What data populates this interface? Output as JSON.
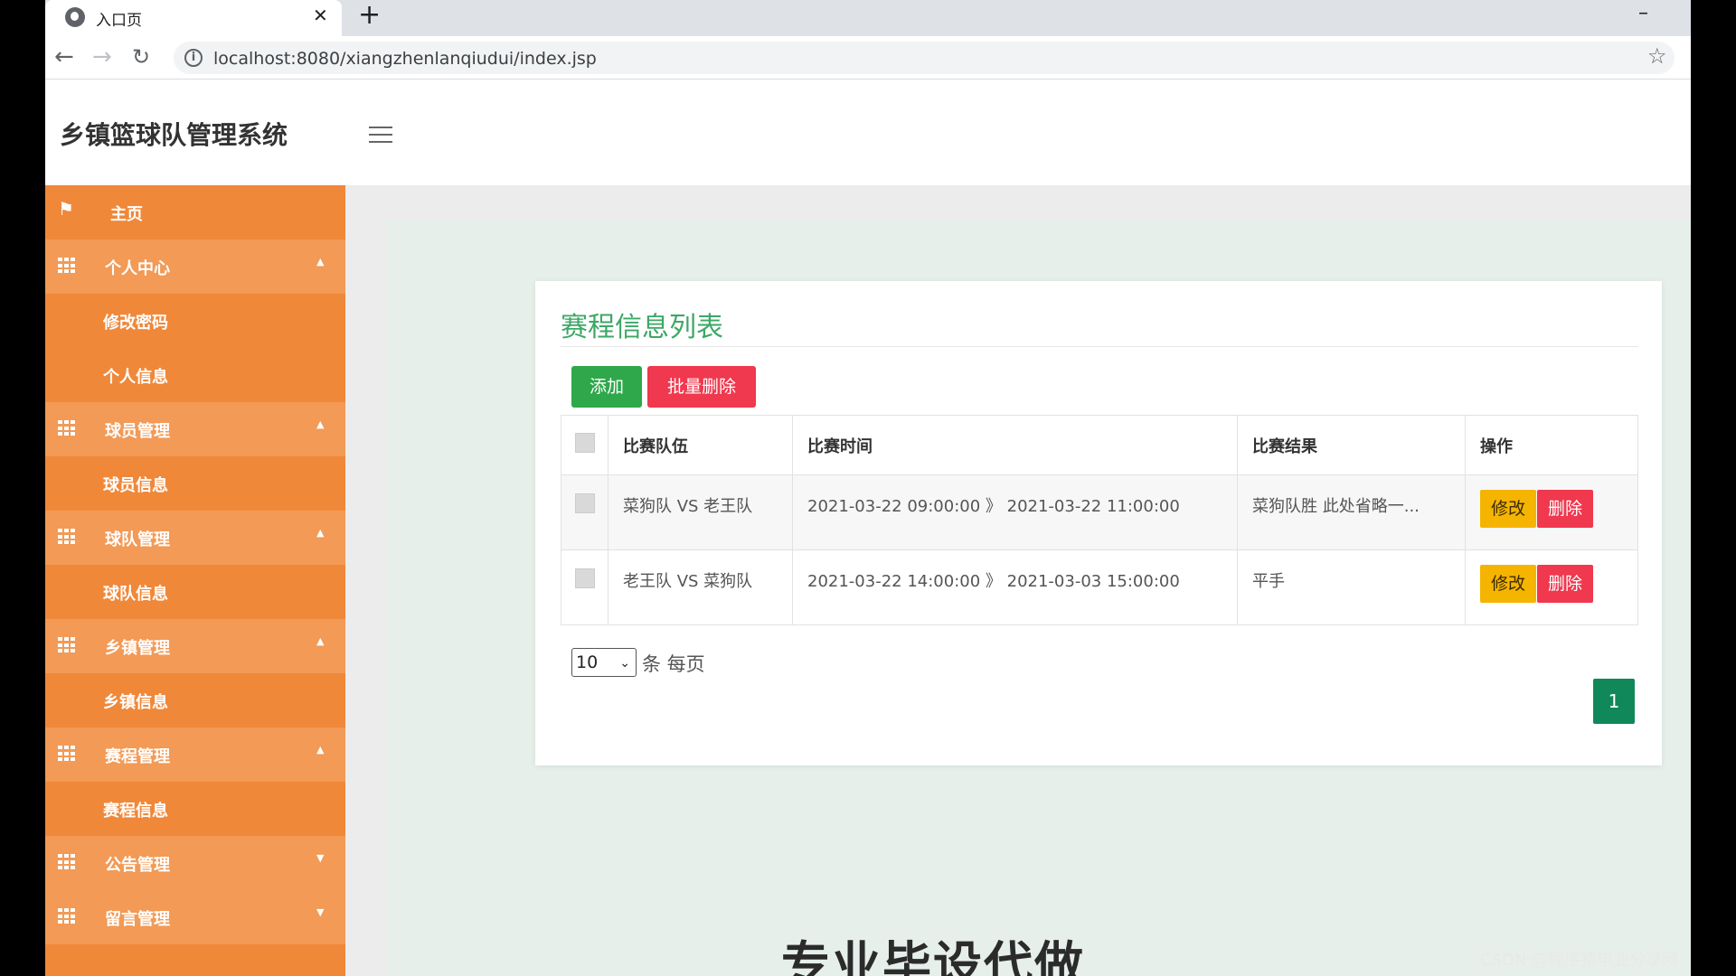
{
  "browser": {
    "tab_title": "入口页",
    "url": "localhost:8080/xiangzhenlanqiudui/index.jsp"
  },
  "app": {
    "title": "乡镇篮球队管理系统"
  },
  "sidebar": {
    "home": "主页",
    "groups": [
      {
        "label": "个人中心",
        "expanded": true,
        "items": [
          "修改密码",
          "个人信息"
        ]
      },
      {
        "label": "球员管理",
        "expanded": true,
        "items": [
          "球员信息"
        ]
      },
      {
        "label": "球队管理",
        "expanded": true,
        "items": [
          "球队信息"
        ]
      },
      {
        "label": "乡镇管理",
        "expanded": true,
        "items": [
          "乡镇信息"
        ]
      },
      {
        "label": "赛程管理",
        "expanded": true,
        "items": [
          "赛程信息"
        ]
      },
      {
        "label": "公告管理",
        "expanded": false,
        "items": []
      },
      {
        "label": "留言管理",
        "expanded": false,
        "items": []
      }
    ]
  },
  "main": {
    "card_title": "赛程信息列表",
    "add_label": "添加",
    "batch_delete_label": "批量删除",
    "columns": [
      "比赛队伍",
      "比赛时间",
      "比赛结果",
      "操作"
    ],
    "rows": [
      {
        "team": "菜狗队 VS 老王队",
        "time": "2021-03-22 09:00:00 》 2021-03-22 11:00:00",
        "result": "菜狗队胜 此处省略一...",
        "edit": "修改",
        "delete": "删除"
      },
      {
        "team": "老王队 VS 菜狗队",
        "time": "2021-03-22 14:00:00 》 2021-03-03 15:00:00",
        "result": "平手",
        "edit": "修改",
        "delete": "删除"
      }
    ],
    "page_size": "10",
    "page_size_suffix": "条 每页",
    "current_page": "1",
    "bottom_heading": "专业毕设代做"
  },
  "watermark": "CSDN @程序猿毕业分享网",
  "colors": {
    "sidebar": "#f0883a",
    "accent_green": "#3ca866",
    "add_button": "#2ea84a",
    "delete_button": "#f0384e",
    "edit_button": "#f5b400",
    "page_button": "#11885a"
  }
}
